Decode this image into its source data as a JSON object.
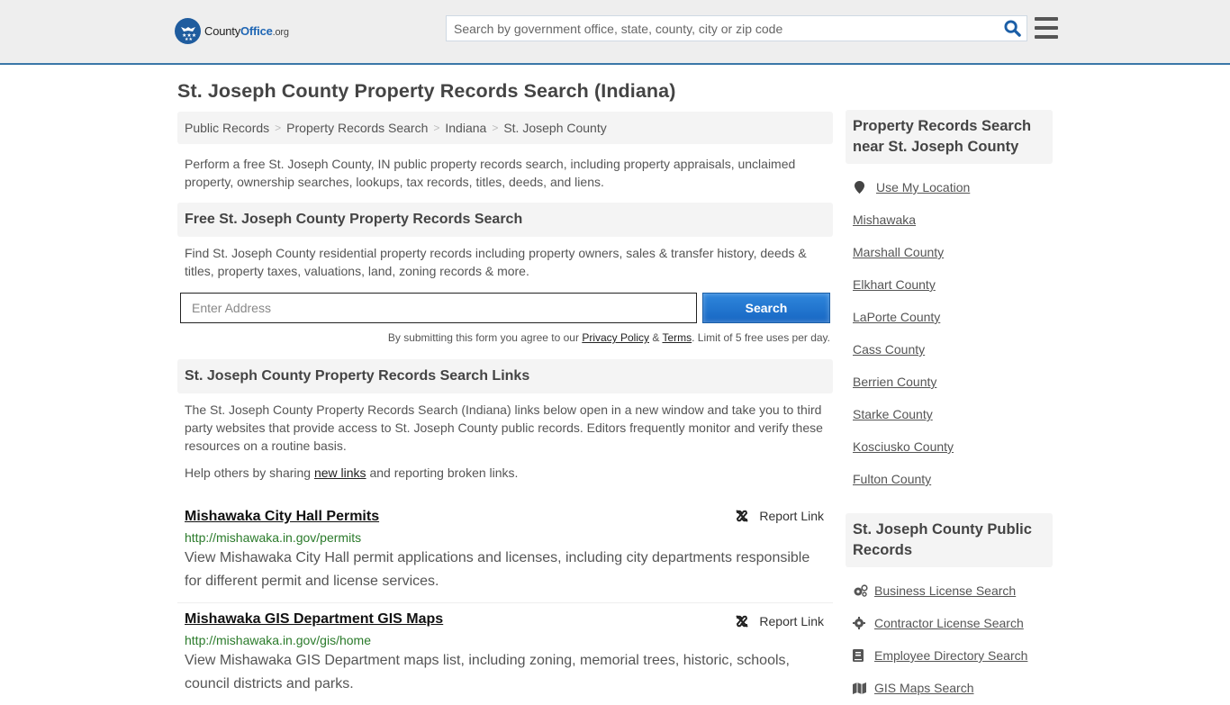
{
  "header": {
    "logo": {
      "county": "County",
      "office": "Office",
      "org": ".org"
    },
    "search_placeholder": "Search by government office, state, county, city or zip code",
    "search_icon": "search-icon",
    "menu_icon": "hamburger-menu-icon"
  },
  "page": {
    "title": "St. Joseph County Property Records Search (Indiana)",
    "breadcrumb": [
      "Public Records",
      "Property Records Search",
      "Indiana",
      "St. Joseph County"
    ],
    "breadcrumb_separator": ">",
    "intro": "Perform a free St. Joseph County, IN public property records search, including property appraisals, unclaimed property, ownership searches, lookups, tax records, titles, deeds, and liens."
  },
  "search_section": {
    "heading": "Free St. Joseph County Property Records Search",
    "description": "Find St. Joseph County residential property records including property owners, sales & transfer history, deeds & titles, property taxes, valuations, land, zoning records & more.",
    "address_placeholder": "Enter Address",
    "button_label": "Search",
    "terms_prefix": "By submitting this form you agree to our ",
    "privacy_label": "Privacy Policy",
    "terms_amp": " & ",
    "terms_label": "Terms",
    "terms_suffix": ". Limit of 5 free uses per day."
  },
  "links_section": {
    "heading": "St. Joseph County Property Records Search Links",
    "description": "The St. Joseph County Property Records Search (Indiana) links below open in a new window and take you to third party websites that provide access to St. Joseph County public records. Editors frequently monitor and verify these resources on a routine basis.",
    "help_prefix": "Help others by sharing ",
    "help_link": "new links",
    "help_suffix": " and reporting broken links.",
    "report_label": "Report Link",
    "items": [
      {
        "title": "Mishawaka City Hall Permits",
        "url": "http://mishawaka.in.gov/permits",
        "description": "View Mishawaka City Hall permit applications and licenses, including city departments responsible for different permit and license services."
      },
      {
        "title": "Mishawaka GIS Department GIS Maps",
        "url": "http://mishawaka.in.gov/gis/home",
        "description": "View Mishawaka GIS Department maps list, including zoning, memorial trees, historic, schools, council districts and parks."
      }
    ]
  },
  "sidebar": {
    "nearby": {
      "heading": "Property Records Search near St. Joseph County",
      "use_location": "Use My Location",
      "items": [
        "Mishawaka",
        "Marshall County",
        "Elkhart County",
        "LaPorte County",
        "Cass County",
        "Berrien County",
        "Starke County",
        "Kosciusko County",
        "Fulton County"
      ]
    },
    "public_records": {
      "heading": "St. Joseph County Public Records",
      "items": [
        {
          "label": "Business License Search",
          "icon": "cogs-icon"
        },
        {
          "label": "Contractor License Search",
          "icon": "gear-icon"
        },
        {
          "label": "Employee Directory Search",
          "icon": "book-icon"
        },
        {
          "label": "GIS Maps Search",
          "icon": "map-icon"
        }
      ]
    }
  },
  "colors": {
    "header_bg": "#eeeeee",
    "header_border": "#3a77a8",
    "brand_blue": "#1f66b4",
    "button_blue": "#1767c3",
    "url_green": "#2a7a2a"
  }
}
